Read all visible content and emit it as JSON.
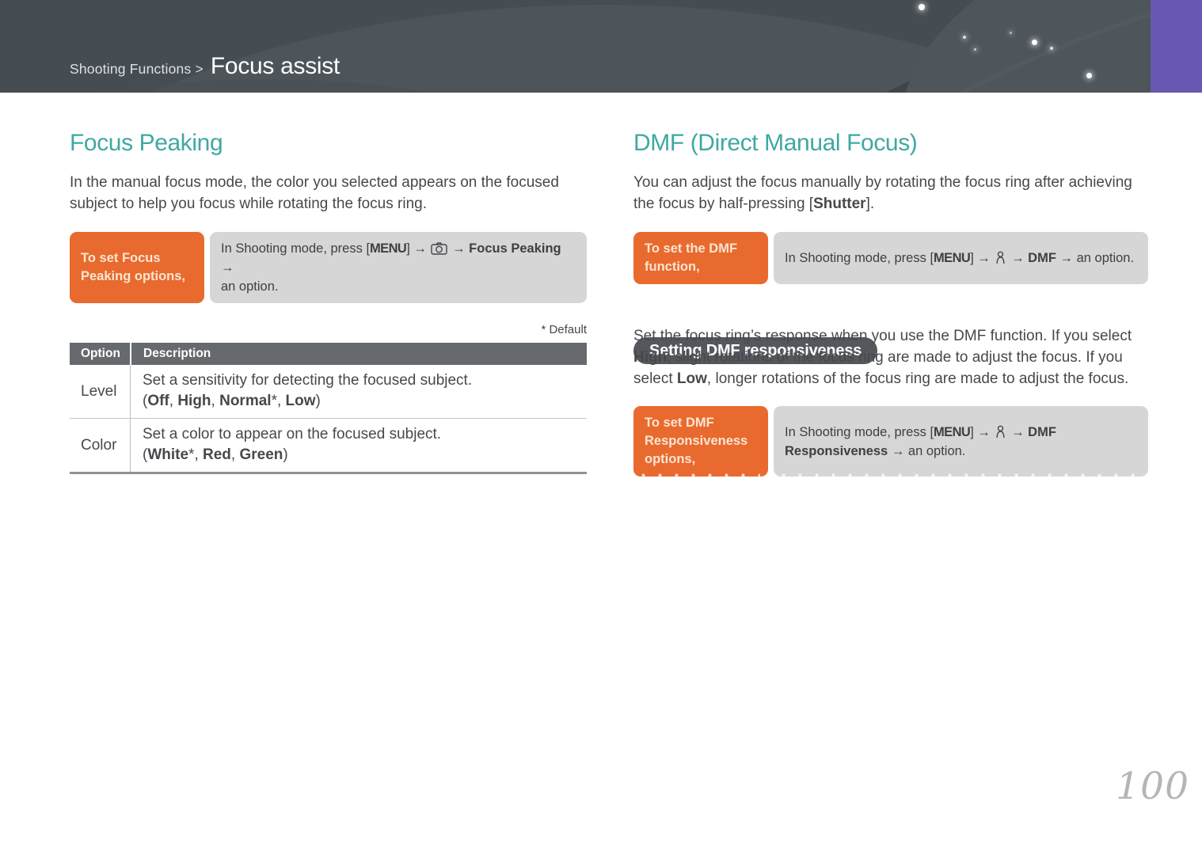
{
  "colors": {
    "accent_purple": "#6a57b2",
    "heading_teal": "#3fa8a2",
    "box_orange": "#e96a2e",
    "box_gray": "#d6d6d6",
    "header_slate": "#454c52",
    "table_header_gray": "#66696d",
    "pill_gray": "#54585d"
  },
  "header": {
    "breadcrumb": "Shooting Functions >",
    "title": "Focus assist"
  },
  "page_number": "100",
  "left": {
    "heading": "Focus Peaking",
    "intro": "In the manual focus mode, the color you selected appears on the focused subject to help you focus while rotating the focus ring.",
    "howto": {
      "label": "To set Focus Peaking options,",
      "instruction": [
        {
          "t": "In Shooting mode, press ["
        },
        {
          "t": "MENU",
          "k": true
        },
        {
          "t": "] → "
        },
        {
          "icon": "camera-menu-icon"
        },
        {
          "t": " → "
        },
        {
          "t": "Focus Peaking",
          "b": true
        },
        {
          "t": " →"
        },
        {
          "br": true
        },
        {
          "t": "an option."
        }
      ]
    },
    "default_note": "* Default",
    "table": {
      "headers": [
        "Option",
        "Description"
      ],
      "rows": [
        {
          "option": "Level",
          "desc": "Set a sensitivity for detecting the focused subject.",
          "opts": [
            {
              "t": "("
            },
            {
              "t": "Off",
              "b": true
            },
            {
              "t": ", "
            },
            {
              "t": "High",
              "b": true
            },
            {
              "t": ", "
            },
            {
              "t": "Normal",
              "b": true
            },
            {
              "t": "*, "
            },
            {
              "t": "Low",
              "b": true
            },
            {
              "t": ")"
            }
          ]
        },
        {
          "option": "Color",
          "desc": "Set a color to appear on the focused subject.",
          "opts": [
            {
              "t": "("
            },
            {
              "t": "White",
              "b": true
            },
            {
              "t": "*, "
            },
            {
              "t": "Red",
              "b": true
            },
            {
              "t": ", "
            },
            {
              "t": "Green",
              "b": true
            },
            {
              "t": ")"
            }
          ]
        }
      ]
    }
  },
  "right": {
    "heading": "DMF (Direct Manual Focus)",
    "intro": [
      {
        "t": "You can adjust the focus manually by rotating the focus ring after achieving the focus by half-pressing ["
      },
      {
        "t": "Shutter",
        "b": true
      },
      {
        "t": "]."
      }
    ],
    "howto1": {
      "label": "To set the DMF function,",
      "instruction": [
        {
          "t": "In Shooting mode, press ["
        },
        {
          "t": "MENU",
          "k": true
        },
        {
          "t": "] → "
        },
        {
          "icon": "custom-menu-icon"
        },
        {
          "t": " → "
        },
        {
          "t": "DMF",
          "b": true
        },
        {
          "t": " → an option."
        }
      ]
    },
    "subsection": "Setting DMF responsiveness",
    "body": [
      {
        "t": "Set the focus ring’s response when you use the DMF function. If you select "
      },
      {
        "t": "High",
        "b": true
      },
      {
        "t": ", slight rotations of the focus ring are made to adjust the focus. If you select "
      },
      {
        "t": "Low",
        "b": true
      },
      {
        "t": ", longer rotations of the focus ring are made to adjust the focus."
      }
    ],
    "howto2": {
      "label": "To set DMF Responsiveness options,",
      "instruction": [
        {
          "t": "In Shooting mode, press ["
        },
        {
          "t": "MENU",
          "k": true
        },
        {
          "t": "] → "
        },
        {
          "icon": "custom-menu-icon"
        },
        {
          "t": " → "
        },
        {
          "t": "DMF",
          "b": true
        },
        {
          "br": true
        },
        {
          "t": "Responsiveness",
          "b": true
        },
        {
          "t": " → an option."
        }
      ]
    }
  }
}
